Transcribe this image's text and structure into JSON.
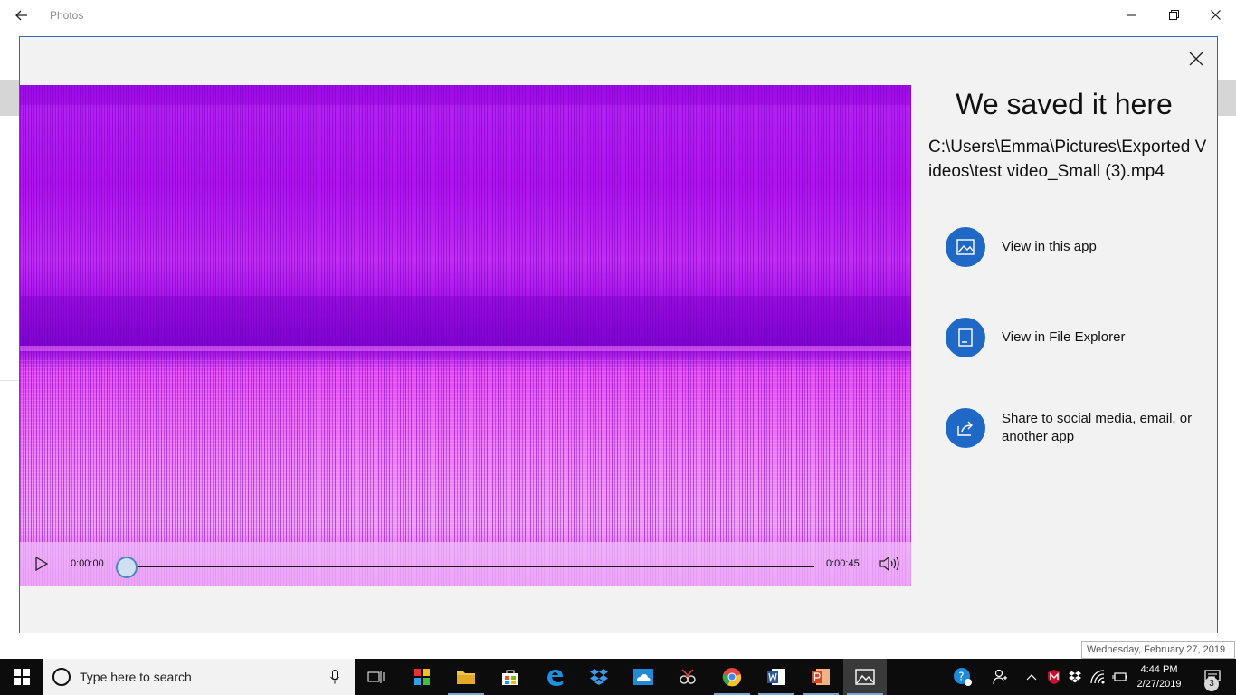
{
  "window": {
    "title": "Photos"
  },
  "dialog": {
    "heading": "We saved it here",
    "path": "C:\\Users\\Emma\\Pictures\\Exported Videos\\test video_Small (3).mp4",
    "actions": [
      {
        "label": "View in this app",
        "icon": "image-icon"
      },
      {
        "label": "View in File Explorer",
        "icon": "file-explorer-icon"
      },
      {
        "label": "Share to social media, email, or another app",
        "icon": "share-icon"
      }
    ]
  },
  "player": {
    "current_time": "0:00:00",
    "end_time": "0:00:45",
    "progress": 0
  },
  "tooltip": {
    "text": "Wednesday, February 27, 2019"
  },
  "taskbar": {
    "search_placeholder": "Type here to search",
    "clock_time": "4:44 PM",
    "clock_date": "2/27/2019",
    "notification_count": "3"
  },
  "colors": {
    "accent": "#2068c6",
    "dialog_border": "#2b6cb3",
    "taskbar": "#0c0c0c"
  }
}
